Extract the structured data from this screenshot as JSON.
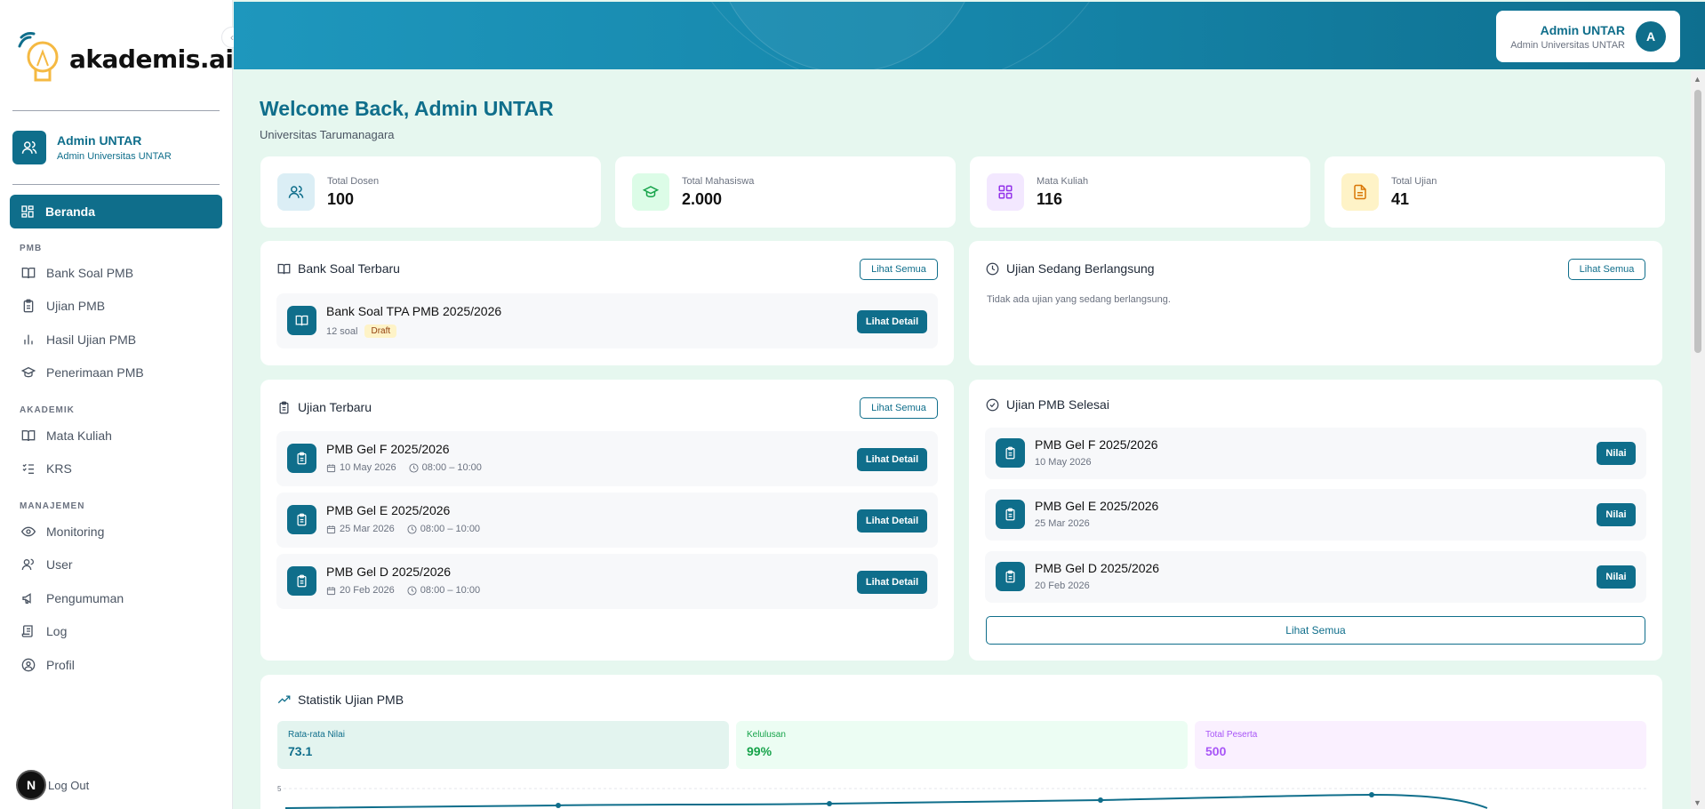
{
  "sidebar": {
    "logo_text": "akademis.ai",
    "user": {
      "name": "Admin UNTAR",
      "role": "Admin Universitas UNTAR"
    },
    "active_item": "Beranda",
    "sections": [
      {
        "label": "PMB",
        "items": [
          "Bank Soal PMB",
          "Ujian PMB",
          "Hasil Ujian PMB",
          "Penerimaan PMB"
        ]
      },
      {
        "label": "AKADEMIK",
        "items": [
          "Mata Kuliah",
          "KRS"
        ]
      },
      {
        "label": "MANAJEMEN",
        "items": [
          "Monitoring",
          "User",
          "Pengumuman",
          "Log",
          "Profil"
        ]
      }
    ],
    "logout": "Log Out",
    "badge": "N"
  },
  "header": {
    "user_name": "Admin UNTAR",
    "user_role": "Admin Universitas UNTAR",
    "avatar_initial": "A"
  },
  "main": {
    "welcome": "Welcome Back, Admin UNTAR",
    "university": "Universitas Tarumanagara",
    "stats": [
      {
        "label": "Total Dosen",
        "value": "100",
        "icon": "users-icon",
        "bg": "#dbeef5",
        "color": "#0f6e8b"
      },
      {
        "label": "Total Mahasiswa",
        "value": "2.000",
        "icon": "graduation-cap-icon",
        "bg": "#dcfce7",
        "color": "#16a34a"
      },
      {
        "label": "Mata Kuliah",
        "value": "116",
        "icon": "grid-icon",
        "bg": "#f3e8ff",
        "color": "#9333ea"
      },
      {
        "label": "Total Ujian",
        "value": "41",
        "icon": "document-icon",
        "bg": "#fef3c7",
        "color": "#d97706"
      }
    ],
    "bank_soal": {
      "title": "Bank Soal Terbaru",
      "see_all": "Lihat Semua",
      "items": [
        {
          "title": "Bank Soal TPA PMB 2025/2026",
          "count": "12 soal",
          "status": "Draft",
          "action": "Lihat Detail"
        }
      ]
    },
    "ujian_berlangsung": {
      "title": "Ujian Sedang Berlangsung",
      "see_all": "Lihat Semua",
      "empty": "Tidak ada ujian yang sedang berlangsung."
    },
    "ujian_terbaru": {
      "title": "Ujian Terbaru",
      "see_all": "Lihat Semua",
      "items": [
        {
          "title": "PMB Gel F 2025/2026",
          "date": "10 May 2026",
          "time": "08:00 – 10:00",
          "action": "Lihat Detail"
        },
        {
          "title": "PMB Gel E 2025/2026",
          "date": "25 Mar 2026",
          "time": "08:00 – 10:00",
          "action": "Lihat Detail"
        },
        {
          "title": "PMB Gel D 2025/2026",
          "date": "20 Feb 2026",
          "time": "08:00 – 10:00",
          "action": "Lihat Detail"
        }
      ]
    },
    "ujian_selesai": {
      "title": "Ujian PMB Selesai",
      "see_all": "Lihat Semua",
      "items": [
        {
          "title": "PMB Gel F 2025/2026",
          "date": "10 May 2026",
          "action": "Nilai"
        },
        {
          "title": "PMB Gel E 2025/2026",
          "date": "25 Mar 2026",
          "action": "Nilai"
        },
        {
          "title": "PMB Gel D 2025/2026",
          "date": "20 Feb 2026",
          "action": "Nilai"
        }
      ]
    },
    "statistik": {
      "title": "Statistik Ujian PMB",
      "metrics": [
        {
          "label": "Rata-rata Nilai",
          "value": "73.1",
          "bg": "#e3f4ef",
          "color": "#0f6e8b"
        },
        {
          "label": "Kelulusan",
          "value": "99%",
          "bg": "#ecfdf3",
          "color": "#16a34a"
        },
        {
          "label": "Total Peserta",
          "value": "500",
          "bg": "#faf0ff",
          "color": "#a855f7"
        }
      ],
      "y_tick_top": "5"
    }
  },
  "colors": {
    "primary": "#0f6e8b",
    "background": "#e6f7ef"
  }
}
